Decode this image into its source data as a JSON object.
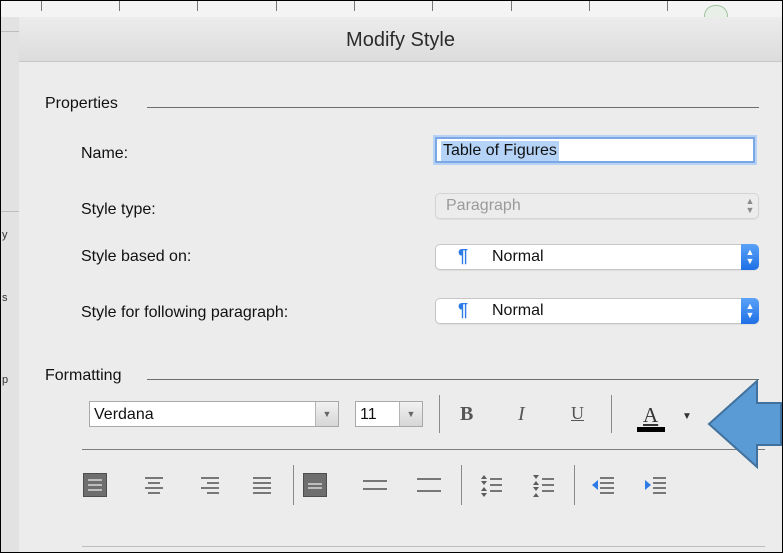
{
  "dialog": {
    "title": "Modify Style"
  },
  "properties": {
    "section_label": "Properties",
    "name_label": "Name:",
    "name_value": "Table of Figures",
    "style_type_label": "Style type:",
    "style_type_value": "Paragraph",
    "based_on_label": "Style based on:",
    "based_on_value": "Normal",
    "following_label": "Style for following paragraph:",
    "following_value": "Normal"
  },
  "formatting": {
    "section_label": "Formatting",
    "font_name": "Verdana",
    "font_size": "11",
    "bold_label": "B",
    "italic_label": "I",
    "underline_label": "U",
    "font_color_label": "A",
    "font_color": "#000000",
    "alignment_buttons": [
      "align-left",
      "align-center",
      "align-right",
      "align-justify"
    ],
    "spacing_buttons": [
      "single-spacing",
      "one-half-spacing",
      "double-spacing"
    ],
    "paragraph_spacing_buttons": [
      "space-before",
      "space-after"
    ],
    "indent_buttons": [
      "decrease-indent",
      "increase-indent"
    ]
  },
  "annotation": {
    "arrow_icon": "blue-left-arrow",
    "arrow_color": "#5b9bd5"
  },
  "colors": {
    "accent": "#2d7be6",
    "selection": "#b4d3f6"
  },
  "background_doc": {
    "left_chars": [
      "y",
      "s",
      "p"
    ]
  }
}
